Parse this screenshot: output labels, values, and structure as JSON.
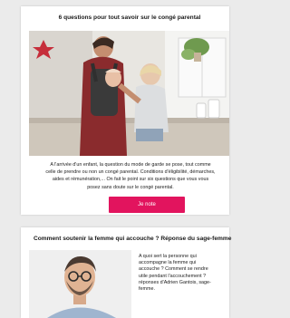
{
  "articles": [
    {
      "title": "6 questions pour tout savoir sur le congé parental",
      "excerpt_lines": [
        "A l'arrivée d'un enfant, la question du mode de garde se pose, tout comme",
        "celle de prendre ou non un congé parental. Conditions d'éligibilité, démarches,",
        "aides et rémunération,... On fait le point sur six questions que vous vous",
        "posez sans doute sur le congé parental."
      ],
      "button_label": "Je note",
      "image_alt": "Père portant un bébé en porte-bébé et un jeune enfant assis sur le comptoir de cuisine"
    },
    {
      "title": "Comment soutenir la femme qui accouche ? Réponse du sage-femme",
      "excerpt_lines": [
        "A quoi sert la personne qui",
        "accompagne la femme qui",
        "accouche ? Comment se rendre",
        "utile pendant l'accouchement ?",
        "réponses d'Adrien Gantois, sage-",
        "femme."
      ],
      "image_alt": "Portrait d'un homme à lunettes"
    }
  ],
  "colors": {
    "accent": "#e2145e",
    "background": "#ebebeb",
    "card": "#ffffff"
  }
}
